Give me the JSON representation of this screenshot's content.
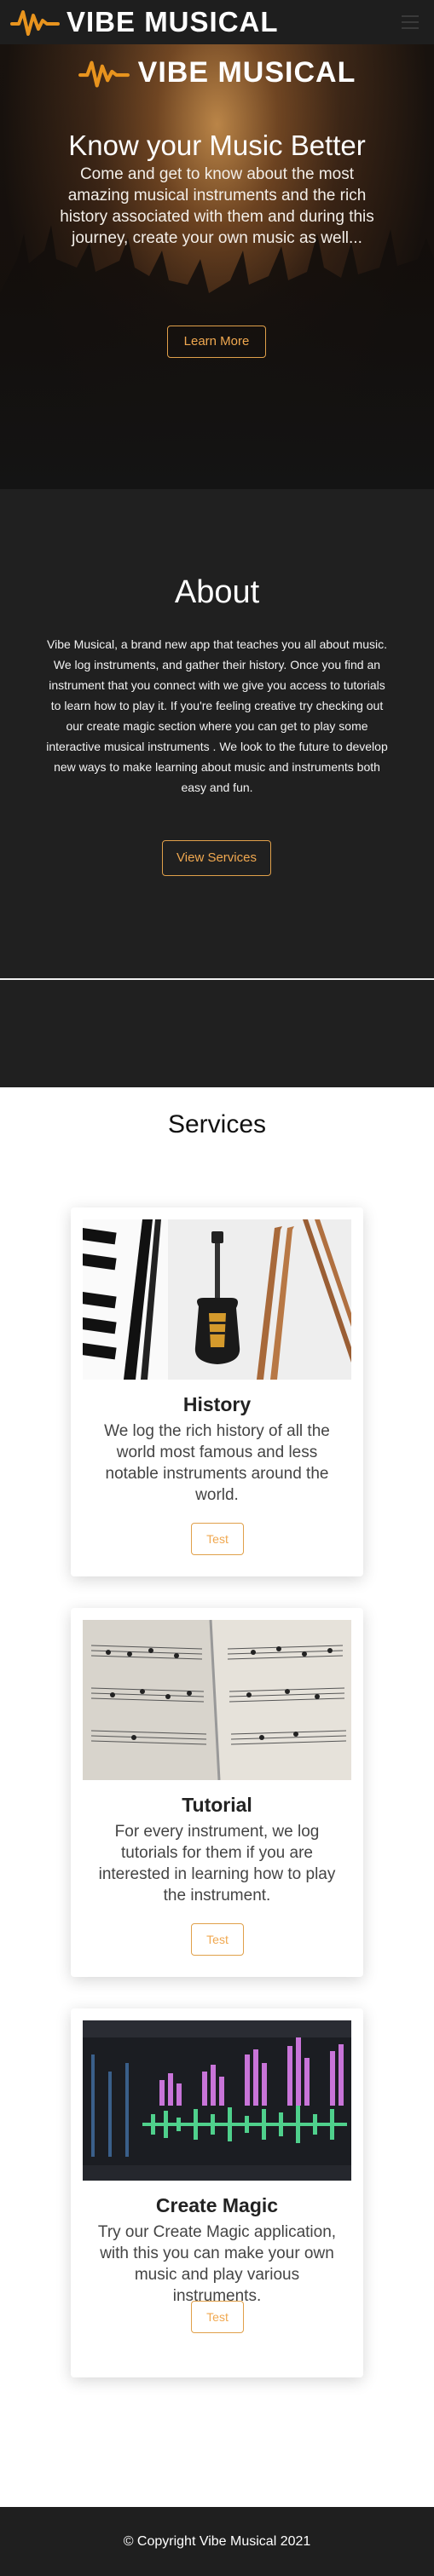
{
  "navbar": {
    "brand": "VIBE MUSICAL",
    "logo_icon": "waveform-logo-icon",
    "toggle_icon": "hamburger-menu-icon"
  },
  "hero": {
    "logo_text": "VIBE MUSICAL",
    "title": "Know your Music Better",
    "subtitle": "Come and get to know about the most amazing musical instruments and the rich history associated with them and during this journey, create your own music as well...",
    "button": "Learn More"
  },
  "about": {
    "title": "About",
    "text": "Vibe Musical, a brand new app that teaches you all about music. We log instruments, and gather their history. Once you find an instrument that you connect with we give you access to tutorials to learn how to play it. If you're feeling creative try checking out our create magic section where you can get to play some interactive musical instruments . We look to the future to develop new ways to make learning about music and instruments both easy and fun.",
    "button": "View Services"
  },
  "services": {
    "title": "Services",
    "cards": [
      {
        "title": "History",
        "text": "We log the rich history of all the world most famous and less notable instruments around the world.",
        "button": "Test"
      },
      {
        "title": "Tutorial",
        "text": "For every instrument, we log tutorials for them if you are interested in learning how to play the instrument.",
        "button": "Test"
      },
      {
        "title": "Create Magic",
        "text": "Try our Create Magic application, with this you can make your own music and play various instruments.",
        "button": "Test"
      }
    ]
  },
  "footer": {
    "copyright": "© Copyright Vibe Musical 2021"
  },
  "colors": {
    "accent": "#f0a850",
    "logo_orange": "#e8941e",
    "dark": "#202020"
  }
}
